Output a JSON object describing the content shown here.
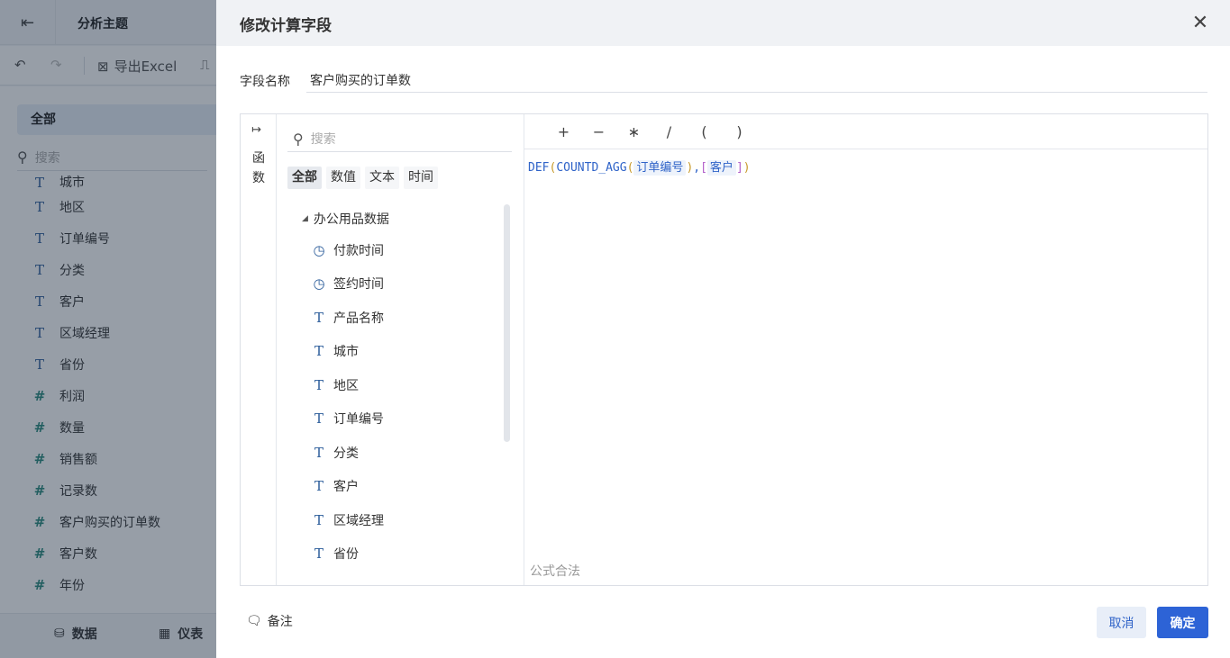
{
  "background": {
    "title": "分析主题",
    "toolbar": {
      "export_label": "导出Excel"
    },
    "sidebar": {
      "all_label": "全部",
      "search_placeholder": "搜索",
      "items": [
        {
          "icon": "text-icon",
          "label": "城市"
        },
        {
          "icon": "text-icon",
          "label": "地区"
        },
        {
          "icon": "text-icon",
          "label": "订单编号"
        },
        {
          "icon": "text-icon",
          "label": "分类"
        },
        {
          "icon": "text-icon",
          "label": "客户"
        },
        {
          "icon": "text-icon",
          "label": "区域经理"
        },
        {
          "icon": "text-icon",
          "label": "省份"
        },
        {
          "icon": "number-icon",
          "label": "利润"
        },
        {
          "icon": "number-icon",
          "label": "数量"
        },
        {
          "icon": "number-icon",
          "label": "销售额"
        },
        {
          "icon": "record-count-icon",
          "label": "记录数"
        },
        {
          "icon": "calc-field-icon",
          "label": "客户购买的订单数"
        },
        {
          "icon": "calc-field-icon",
          "label": "客户数"
        },
        {
          "icon": "calc-field-icon",
          "label": "年份"
        }
      ]
    },
    "bottom_tabs": {
      "data_label": "数据",
      "dashboard_label": "仪表"
    }
  },
  "dialog": {
    "title": "修改计算字段",
    "field_name_label": "字段名称",
    "field_name_value": "客户购买的订单数",
    "functions_label": [
      "函",
      "数"
    ],
    "field_search_placeholder": "搜索",
    "tabs": [
      "全部",
      "数值",
      "文本",
      "时间"
    ],
    "active_tab": "全部",
    "tree": {
      "root": "办公用品数据",
      "items": [
        {
          "icon": "clock-icon",
          "label": "付款时间"
        },
        {
          "icon": "clock-icon",
          "label": "签约时间"
        },
        {
          "icon": "text-icon",
          "label": "产品名称"
        },
        {
          "icon": "text-icon",
          "label": "城市"
        },
        {
          "icon": "text-icon",
          "label": "地区"
        },
        {
          "icon": "text-icon",
          "label": "订单编号"
        },
        {
          "icon": "text-icon",
          "label": "分类"
        },
        {
          "icon": "text-icon",
          "label": "客户"
        },
        {
          "icon": "text-icon",
          "label": "区域经理"
        },
        {
          "icon": "text-icon",
          "label": "省份"
        }
      ]
    },
    "operators": [
      "+",
      "−",
      "∗",
      "/",
      "(",
      ")"
    ],
    "formula": {
      "fn_def": "DEF",
      "fn_countd": "COUNTD_AGG",
      "field1": "订单编号",
      "field2": "客户",
      "comma": ",",
      "open_bracket": "[",
      "close_bracket": "]",
      "open_paren": "(",
      "close_paren": ")"
    },
    "status": "公式合法",
    "note_label": "备注",
    "cancel_label": "取消",
    "ok_label": "确定"
  },
  "colors": {
    "accent": "#2d63d6",
    "overlay": "rgba(25,40,60,0.45)",
    "field_icon": "#2b5c9a",
    "number_icon": "#2b8a7e"
  }
}
